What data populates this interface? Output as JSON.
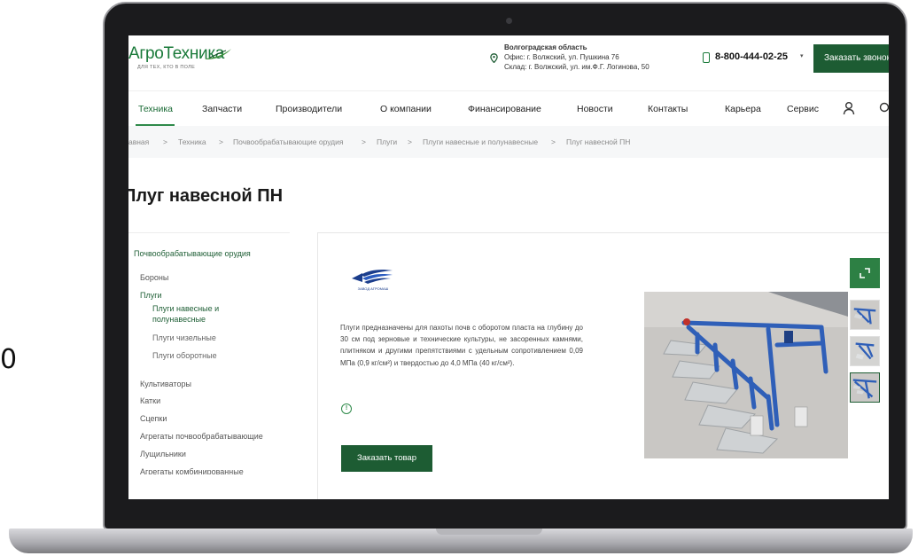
{
  "stray_text": "0",
  "header": {
    "logo": "АгроТехника",
    "logo_tagline": "ДЛЯ ТЕХ, КТО В ПОЛЕ",
    "region": "Волгоградская область",
    "office": "Офис: г. Волжский, ул. Пушкина 76",
    "warehouse": "Склад: г. Волжский, ул. им.Ф.Г. Логинова, 50",
    "phone": "8-800-444-02-25",
    "callback_label": "Заказать звонок"
  },
  "nav": {
    "items": [
      "Техника",
      "Запчасти",
      "Производители",
      "О компании",
      "Финансирование",
      "Новости",
      "Контакты",
      "Карьера",
      "Сервис"
    ],
    "active": "Техника"
  },
  "breadcrumb": [
    "авная",
    "Техника",
    "Почвообрабатывающие орудия",
    "Плуги",
    "Плуги навесные и полунавесные",
    "Плуг навесной ПН"
  ],
  "page_title": "Плуг навесной ПН",
  "sidebar": {
    "heading": "Почвообрабатывающие орудия",
    "items": [
      "Бороны",
      "Плуги",
      "Плуги навесные и",
      "полунавесные",
      "Плуги чизельные",
      "Плуги оборотные",
      "Культиваторы",
      "Катки",
      "Сцепки",
      "Агрегаты почвообрабатывающие",
      "Лущильники",
      "Агрегаты комбинированные"
    ]
  },
  "product": {
    "brand_label": "ЗАВОД АГРОМАШ",
    "description": "Плуги предназначены для пахоты почв с оборотом пласта на глубину до 30 см под зерновые и технические культуры, не засоренных камнями, плитняком и другими препятствиями с удельным сопротивлением 0,09 МПа (0,9 кг/см²) и твердостью до 4,0 МПа (40 кг/см²).",
    "info_symbol": "!",
    "order_label": "Заказать товар"
  },
  "colors": {
    "brand_green": "#1d5c33",
    "accent_green": "#2f8a4a",
    "plough_blue": "#2f5fb8"
  },
  "icons": [
    "location-pin-icon",
    "phone-icon",
    "chevron-down-icon",
    "user-icon",
    "search-icon",
    "info-icon",
    "expand-icon",
    "camera-icon"
  ]
}
